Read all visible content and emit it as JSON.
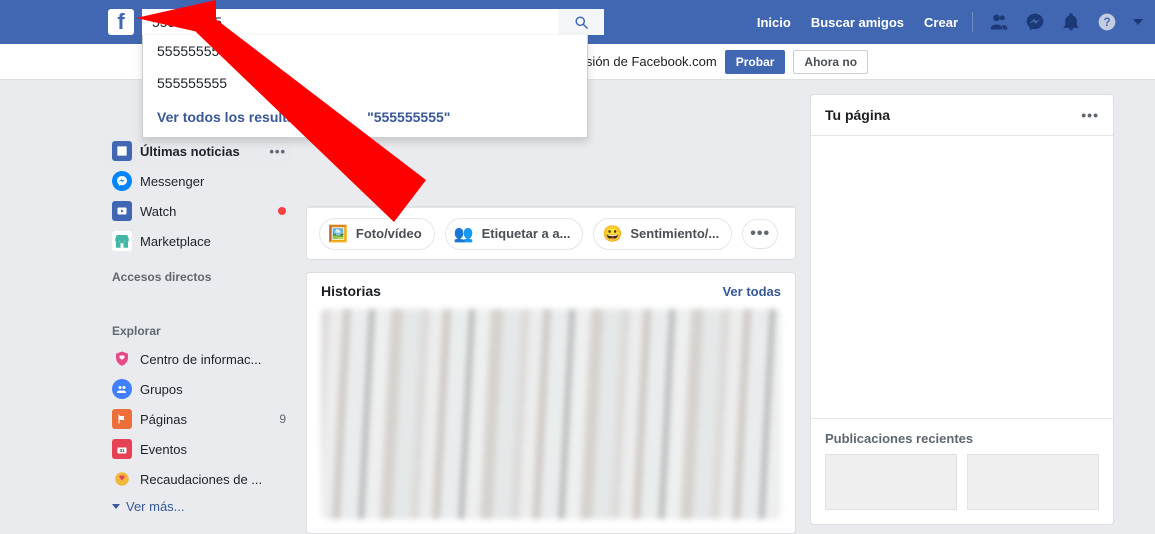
{
  "search": {
    "value": "555555555",
    "suggestions": [
      {
        "prefix": "5555555555",
        "bold": "55"
      },
      {
        "prefix": "555555555",
        "bold": ""
      }
    ],
    "see_all_prefix": "Ver todos los resultados p",
    "see_all_query": "\"555555555\""
  },
  "toplinks": {
    "home": "Inicio",
    "find_friends": "Buscar amigos",
    "create": "Crear"
  },
  "notice": {
    "text": "a nueva versión de Facebook.com",
    "try": "Probar",
    "not_now": "Ahora no"
  },
  "left": {
    "feed": "Últimas noticias",
    "messenger": "Messenger",
    "watch": "Watch",
    "marketplace": "Marketplace",
    "shortcuts_heading": "Accesos directos",
    "explore_heading": "Explorar",
    "info_center": "Centro de informac...",
    "groups": "Grupos",
    "pages": "Páginas",
    "pages_count": "9",
    "events": "Eventos",
    "fundraisers": "Recaudaciones de ...",
    "see_more": "Ver más..."
  },
  "composer": {
    "photo": "Foto/vídeo",
    "tag": "Etiquetar a a...",
    "feeling": "Sentimiento/..."
  },
  "stories": {
    "title": "Historias",
    "see_all": "Ver todas"
  },
  "right": {
    "your_page": "Tu página",
    "recent_posts": "Publicaciones recientes"
  }
}
